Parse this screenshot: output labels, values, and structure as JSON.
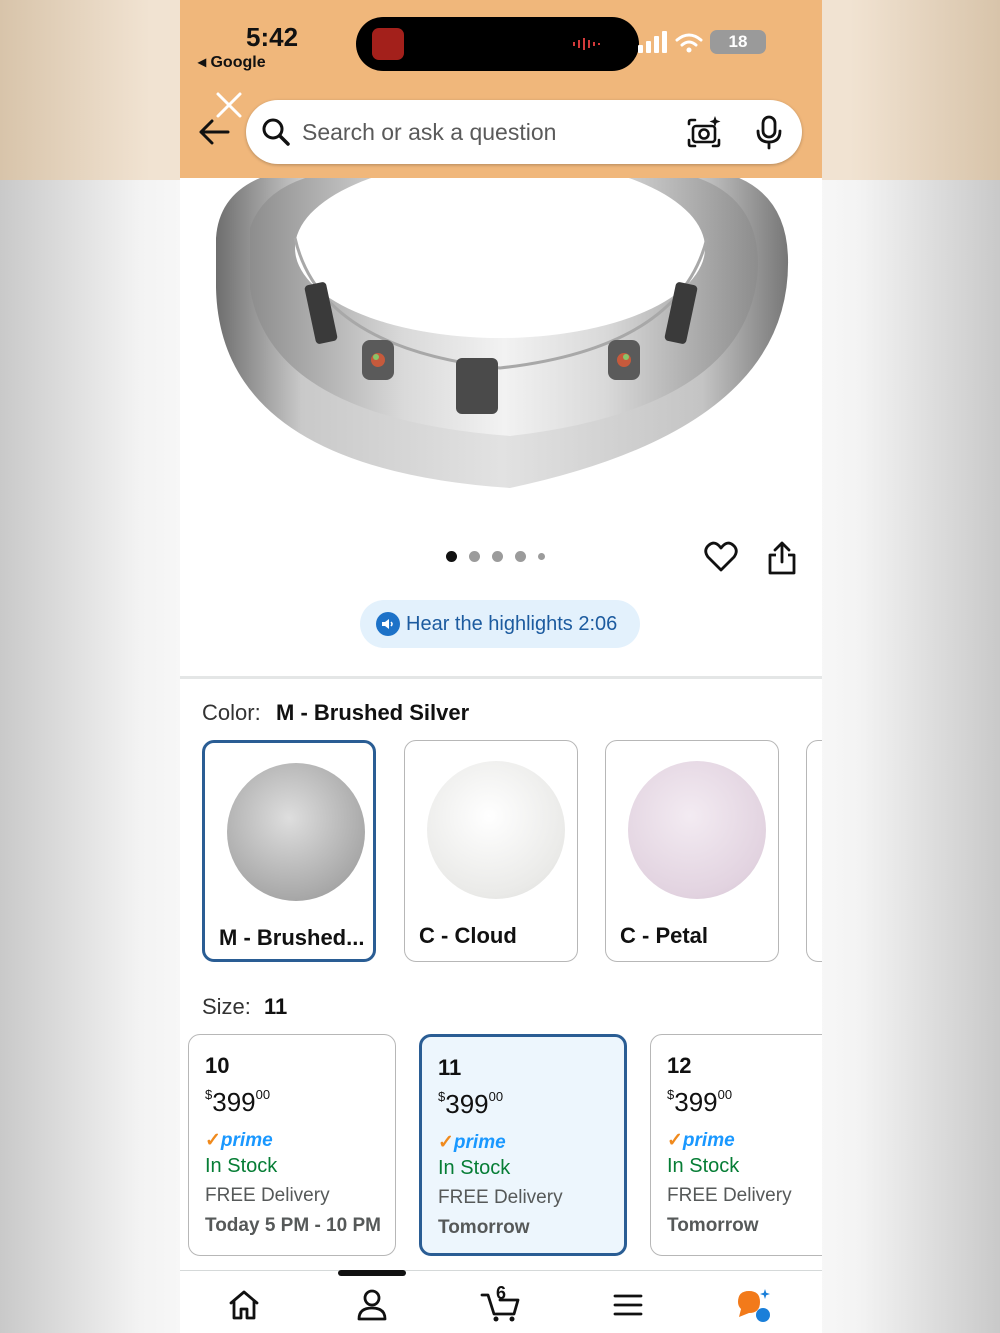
{
  "status_bar": {
    "time": "5:42",
    "back_label": "◂ Google",
    "battery": "18"
  },
  "header": {
    "search_placeholder": "Search or ask a question"
  },
  "gallery": {
    "image_name": "smart-ring-brushed-silver",
    "page_count": 5,
    "active_page": 1
  },
  "highlights": {
    "label": "Hear the highlights 2:06"
  },
  "color": {
    "label": "Color:",
    "selected": "M - Brushed Silver",
    "options": [
      {
        "label": "M - Brushed...",
        "color": "#b5b5b5"
      },
      {
        "label": "C - Cloud",
        "color": "#ececea"
      },
      {
        "label": "C - Petal",
        "color": "#e6d8e4"
      }
    ]
  },
  "size": {
    "label": "Size:",
    "selected": "11",
    "options": [
      {
        "size": "10",
        "currency": "$",
        "price": "399",
        "cents": "00",
        "prime": "prime",
        "stock": "In Stock",
        "delivery": "FREE Delivery",
        "when": "Today 5 PM - 10 PM"
      },
      {
        "size": "11",
        "currency": "$",
        "price": "399",
        "cents": "00",
        "prime": "prime",
        "stock": "In Stock",
        "delivery": "FREE Delivery",
        "when": "Tomorrow"
      },
      {
        "size": "12",
        "currency": "$",
        "price": "399",
        "cents": "00",
        "prime": "prime",
        "stock": "In Stock",
        "delivery": "FREE Delivery",
        "when": "Tomorrow"
      }
    ]
  },
  "bottom_nav": {
    "cart_count": "6",
    "items": [
      "home-icon",
      "account-icon",
      "cart-icon",
      "menu-icon",
      "rufus-icon"
    ]
  },
  "colors": {
    "header_bg": "#f0b77b",
    "selected_border": "#2a5d94",
    "in_stock": "#067d35",
    "prime_blue": "#1a98ff",
    "link_blue": "#1c5b9f"
  }
}
